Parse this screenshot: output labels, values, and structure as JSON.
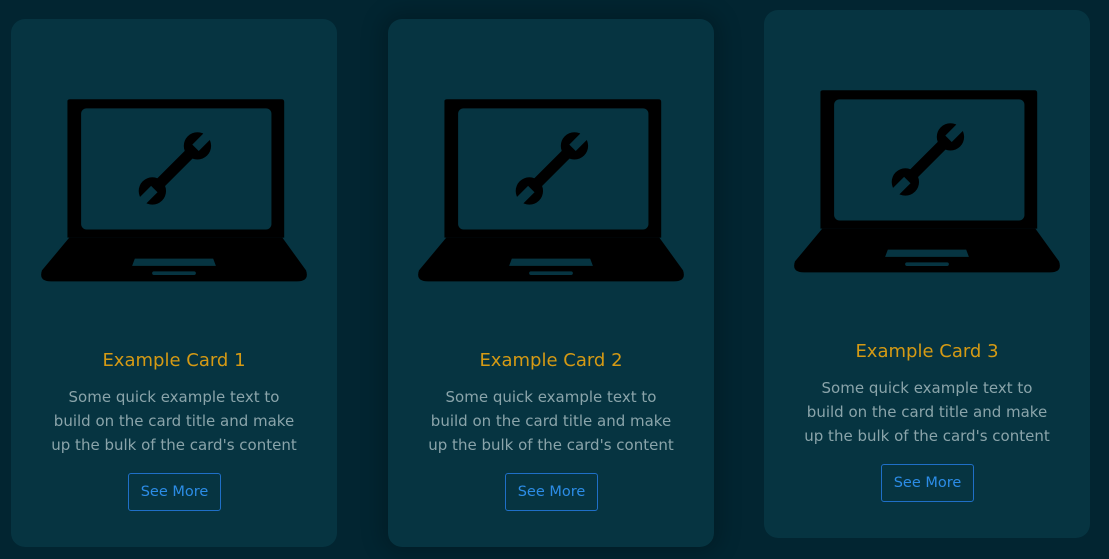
{
  "cards": [
    {
      "title": "Example Card 1",
      "text": "Some quick example text to build on the card title and make up the bulk of the card's content",
      "button_label": "See More",
      "icon": "laptop-wrench-icon"
    },
    {
      "title": "Example Card 2",
      "text": "Some quick example text to build on the card title and make up the bulk of the card's content",
      "button_label": "See More",
      "icon": "laptop-wrench-icon"
    },
    {
      "title": "Example Card 3",
      "text": "Some quick example text to build on the card title and make up the bulk of the card's content",
      "button_label": "See More",
      "icon": "laptop-wrench-icon"
    }
  ],
  "colors": {
    "background": "#022531",
    "card": "#063441",
    "title": "#d59a14",
    "text": "#8aa4aa",
    "button": "#2c8ce6",
    "icon": "#000000"
  }
}
